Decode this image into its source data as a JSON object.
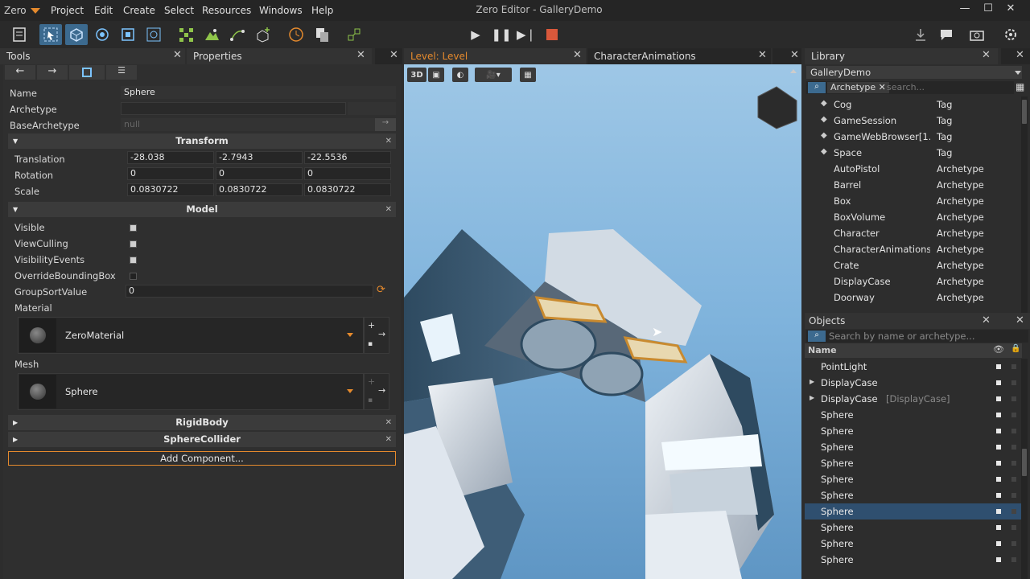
{
  "app": {
    "logo": "Zero",
    "window_title": "Zero Editor - GalleryDemo"
  },
  "menu": [
    "Project",
    "Edit",
    "Create",
    "Select",
    "Resources",
    "Windows",
    "Help"
  ],
  "tabs": {
    "tools": "Tools",
    "properties": "Properties",
    "level": "Level: Level",
    "character_animations": "CharacterAnimations",
    "library": "Library",
    "objects": "Objects"
  },
  "properties": {
    "name_label": "Name",
    "name_value": "Sphere",
    "archetype_label": "Archetype",
    "base_archetype_label": "BaseArchetype",
    "base_archetype_value": "null",
    "transform": {
      "title": "Transform",
      "translation_label": "Translation",
      "translation": [
        "-28.038",
        "-2.7943",
        "-22.5536"
      ],
      "rotation_label": "Rotation",
      "rotation": [
        "0",
        "0",
        "0"
      ],
      "scale_label": "Scale",
      "scale": [
        "0.0830722",
        "0.0830722",
        "0.0830722"
      ]
    },
    "model": {
      "title": "Model",
      "visible_label": "Visible",
      "view_culling_label": "ViewCulling",
      "visibility_events_label": "VisibilityEvents",
      "override_bounding_box_label": "OverrideBoundingBox",
      "group_sort_value_label": "GroupSortValue",
      "group_sort_value": "0",
      "material_label": "Material",
      "material_value": "ZeroMaterial",
      "mesh_label": "Mesh",
      "mesh_value": "Sphere"
    },
    "rigid_body": "RigidBody",
    "sphere_collider": "SphereCollider",
    "add_component": "Add Component..."
  },
  "viewport": {
    "mode_label": "3D"
  },
  "library": {
    "project": "GalleryDemo",
    "filter_tag": "Archetype",
    "search_placeholder": "search...",
    "items": [
      {
        "name": "Cog",
        "type": "Tag"
      },
      {
        "name": "GameSession",
        "type": "Tag"
      },
      {
        "name": "GameWebBrowser[1...",
        "type": "Tag"
      },
      {
        "name": "Space",
        "type": "Tag"
      },
      {
        "name": "AutoPistol",
        "type": "Archetype"
      },
      {
        "name": "Barrel",
        "type": "Archetype"
      },
      {
        "name": "Box",
        "type": "Archetype"
      },
      {
        "name": "BoxVolume",
        "type": "Archetype"
      },
      {
        "name": "Character",
        "type": "Archetype"
      },
      {
        "name": "CharacterAnimations",
        "type": "Archetype"
      },
      {
        "name": "Crate",
        "type": "Archetype"
      },
      {
        "name": "DisplayCase",
        "type": "Archetype"
      },
      {
        "name": "Doorway",
        "type": "Archetype"
      }
    ]
  },
  "objects": {
    "search_placeholder": "Search by name or archetype...",
    "name_header": "Name",
    "items": [
      {
        "name": "PointLight",
        "archetype": ""
      },
      {
        "name": "DisplayCase",
        "archetype": ""
      },
      {
        "name": "DisplayCase",
        "archetype": "[DisplayCase]"
      },
      {
        "name": "Sphere",
        "archetype": ""
      },
      {
        "name": "Sphere",
        "archetype": ""
      },
      {
        "name": "Sphere",
        "archetype": ""
      },
      {
        "name": "Sphere",
        "archetype": ""
      },
      {
        "name": "Sphere",
        "archetype": ""
      },
      {
        "name": "Sphere",
        "archetype": ""
      },
      {
        "name": "Sphere",
        "archetype": "",
        "selected": true
      },
      {
        "name": "Sphere",
        "archetype": ""
      },
      {
        "name": "Sphere",
        "archetype": ""
      },
      {
        "name": "Sphere",
        "archetype": ""
      },
      {
        "name": "Sphere",
        "archetype": ""
      }
    ]
  },
  "colors": {
    "accent": "#e58a2d",
    "selection": "#2f4f6f",
    "level_tab_text": "#e58a2d"
  }
}
